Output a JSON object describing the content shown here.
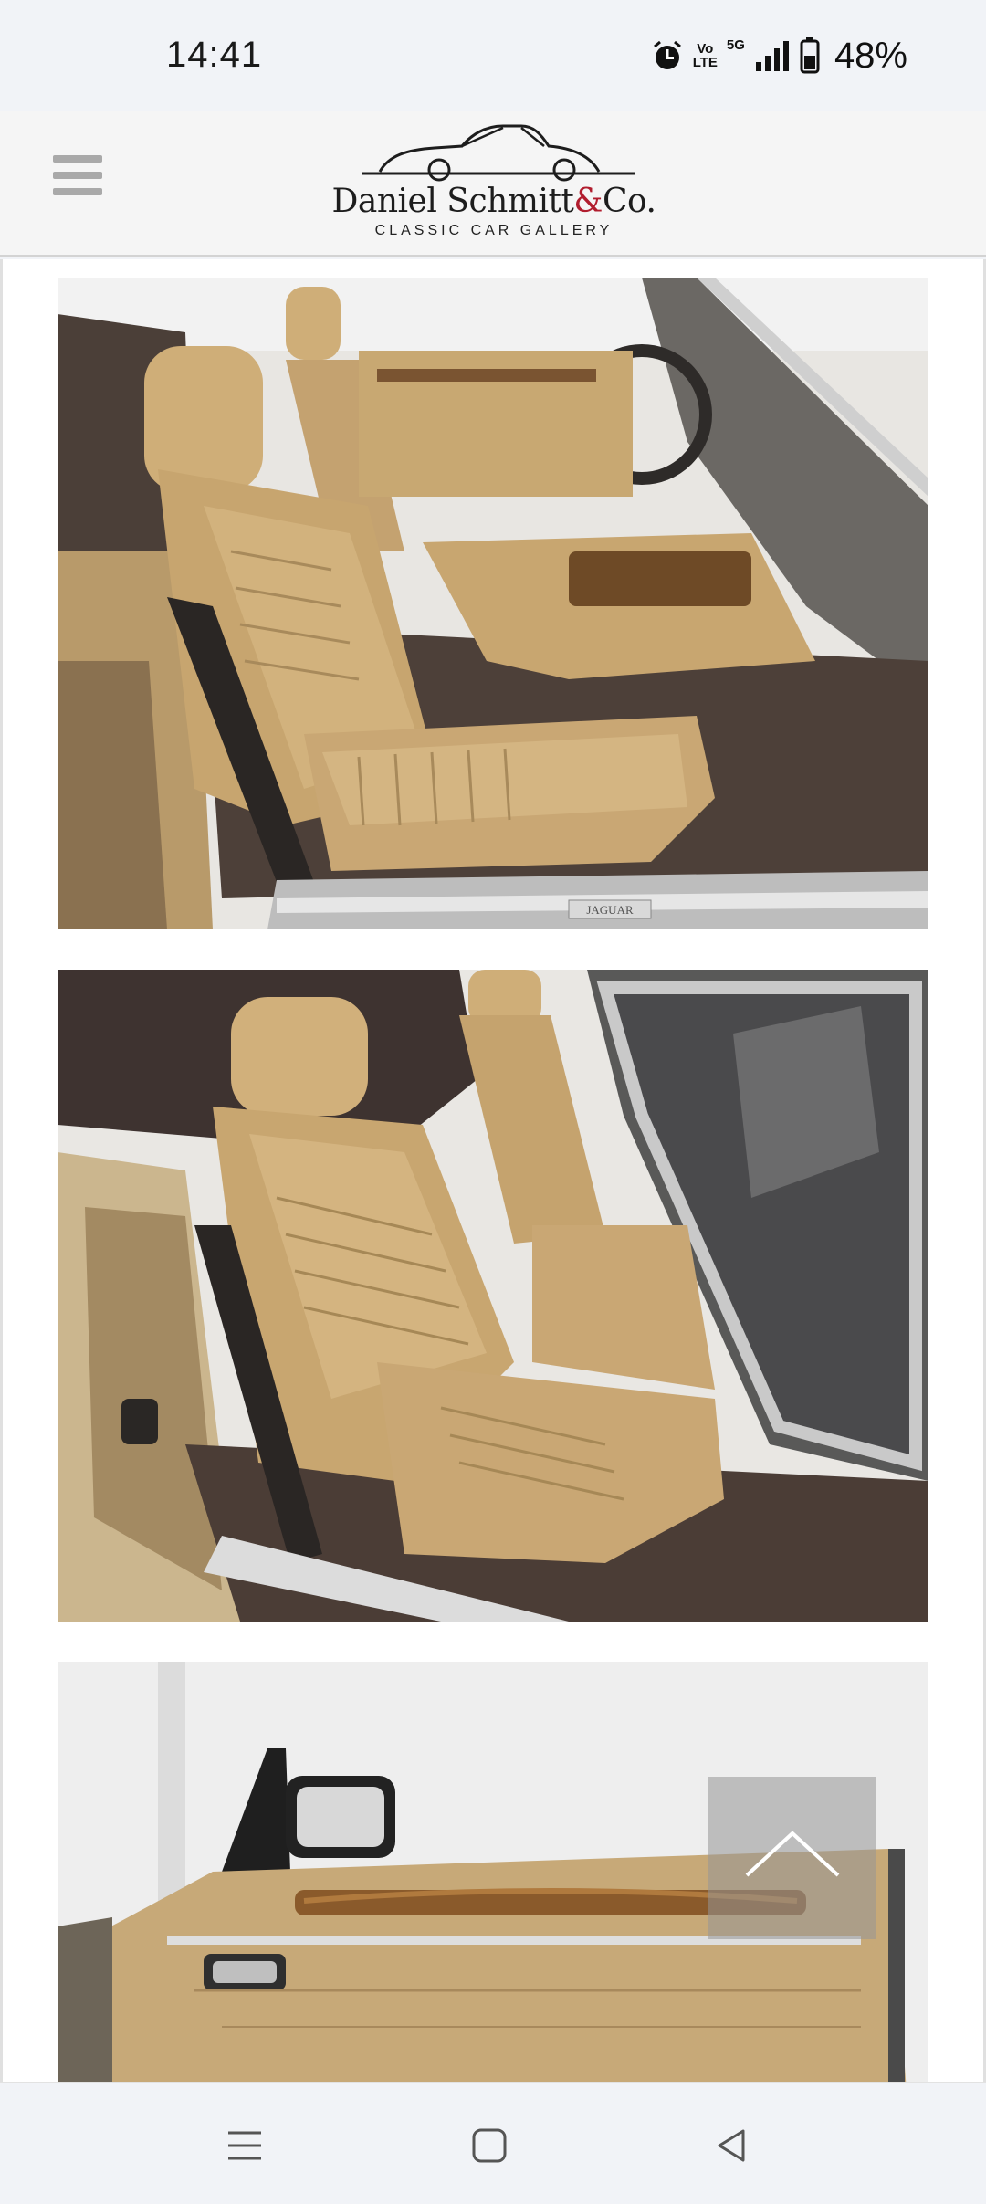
{
  "status_bar": {
    "time": "14:41",
    "volte_line1": "Vo",
    "volte_line2": "LTE",
    "network": "5G",
    "battery_percent": "48%",
    "icons": [
      "alarm-icon",
      "volte-icon",
      "signal-icon",
      "battery-icon"
    ]
  },
  "header": {
    "logo_brand_name": "Daniel Schmitt",
    "logo_brand_amp": "&",
    "logo_brand_suffix": "Co.",
    "logo_tagline": "CLASSIC CAR GALLERY",
    "menu_icon": "hamburger-menu-icon"
  },
  "gallery": {
    "photos": [
      {
        "description_icon": "photo",
        "badge_text": "JAGUAR"
      },
      {
        "description_icon": "photo",
        "badge_text": ""
      },
      {
        "description_icon": "photo",
        "badge_text": ""
      }
    ]
  },
  "scroll_top_icon": "chevron-up-icon",
  "nav_bar": {
    "icons": [
      "recent-apps-icon",
      "home-icon",
      "back-icon"
    ]
  },
  "colors": {
    "accent_amp": "#b11d2e",
    "leather": "#c9a874",
    "carpet": "#4a3c34"
  }
}
